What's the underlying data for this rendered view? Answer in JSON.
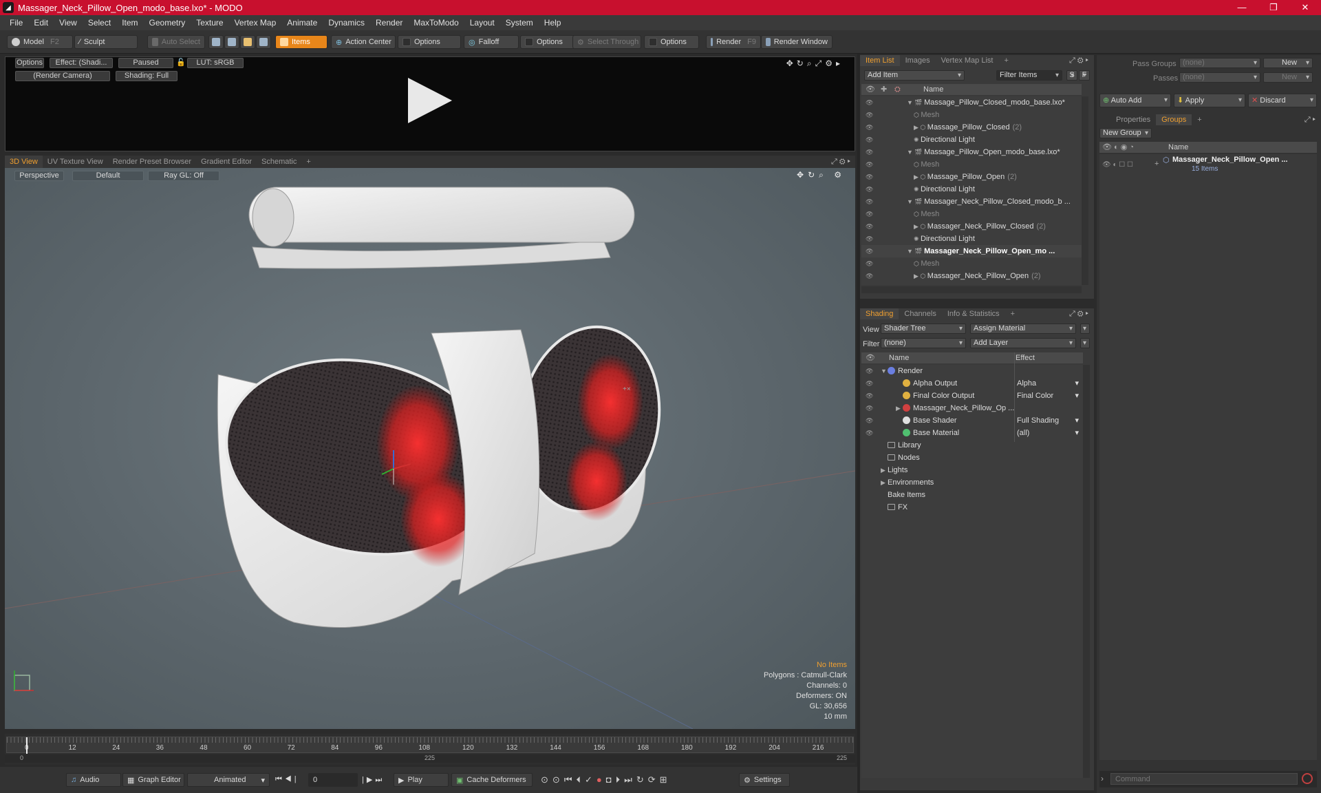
{
  "window": {
    "title": "Massager_Neck_Pillow_Open_modo_base.lxo* - MODO",
    "app_icon": "modo-logo-icon",
    "buttons": [
      "—",
      "❐",
      "✕"
    ]
  },
  "menu": [
    "File",
    "Edit",
    "View",
    "Select",
    "Item",
    "Geometry",
    "Texture",
    "Vertex Map",
    "Animate",
    "Dynamics",
    "Render",
    "MaxToModo",
    "Layout",
    "System",
    "Help"
  ],
  "toolbar": {
    "model": "Model",
    "model_key": "F2",
    "sculpt": "Sculpt",
    "auto_select": "Auto Select",
    "items": "Items",
    "action_center": "Action Center",
    "options1": "Options",
    "falloff": "Falloff",
    "options2": "Options",
    "select_through": "Select Through",
    "options3": "Options",
    "render": "Render",
    "render_key": "F9",
    "render_window": "Render Window"
  },
  "preview": {
    "options": "Options",
    "effect": "Effect: (Shadi...",
    "paused": "Paused",
    "lut": "LUT: sRGB",
    "camera": "(Render Camera)",
    "shading": "Shading: Full"
  },
  "viewport_tabs": [
    "3D View",
    "UV Texture View",
    "Render Preset Browser",
    "Gradient Editor",
    "Schematic",
    "+"
  ],
  "viewport": {
    "perspective": "Perspective",
    "default": "Default",
    "raygl": "Ray GL: Off",
    "stats": {
      "no_items": "No Items",
      "polygons": "Polygons : Catmull-Clark",
      "channels": "Channels: 0",
      "deformers": "Deformers: ON",
      "gl": "GL: 30,656",
      "scale": "10 mm"
    }
  },
  "timeline": {
    "ticks": [
      "0",
      "12",
      "24",
      "36",
      "48",
      "60",
      "72",
      "84",
      "96",
      "108",
      "120",
      "132",
      "144",
      "156",
      "168",
      "180",
      "192",
      "204",
      "216"
    ],
    "start": "0",
    "end_mid": "225",
    "end": "225"
  },
  "bottombar": {
    "audio": "Audio",
    "graph_editor": "Graph Editor",
    "animated": "Animated",
    "frame": "0",
    "play": "Play",
    "cache_deformers": "Cache Deformers",
    "settings": "Settings"
  },
  "item_list": {
    "tabs": [
      "Item List",
      "Images",
      "Vertex Map List",
      "+"
    ],
    "add_item": "Add Item",
    "filter_items": "Filter Items",
    "s_btn": "S",
    "f_btn": "F",
    "col_name": "Name",
    "rows": [
      {
        "label": "Massage_Pillow_Closed_modo_base.lxo*",
        "indent": 0,
        "kind": "scene",
        "count": ""
      },
      {
        "label": "Mesh",
        "indent": 1,
        "kind": "mesh",
        "count": ""
      },
      {
        "label": "Massage_Pillow_Closed",
        "indent": 1,
        "kind": "group",
        "count": "(2)"
      },
      {
        "label": "Directional Light",
        "indent": 1,
        "kind": "light",
        "count": ""
      },
      {
        "label": "Massage_Pillow_Open_modo_base.lxo*",
        "indent": 0,
        "kind": "scene",
        "count": ""
      },
      {
        "label": "Mesh",
        "indent": 1,
        "kind": "mesh",
        "count": ""
      },
      {
        "label": "Massage_Pillow_Open",
        "indent": 1,
        "kind": "group",
        "count": "(2)"
      },
      {
        "label": "Directional Light",
        "indent": 1,
        "kind": "light",
        "count": ""
      },
      {
        "label": "Massager_Neck_Pillow_Closed_modo_b ...",
        "indent": 0,
        "kind": "scene",
        "count": ""
      },
      {
        "label": "Mesh",
        "indent": 1,
        "kind": "mesh",
        "count": ""
      },
      {
        "label": "Massager_Neck_Pillow_Closed",
        "indent": 1,
        "kind": "group",
        "count": "(2)"
      },
      {
        "label": "Directional Light",
        "indent": 1,
        "kind": "light",
        "count": ""
      },
      {
        "label": "Massager_Neck_Pillow_Open_mo ...",
        "indent": 0,
        "kind": "scene-bold",
        "count": ""
      },
      {
        "label": "Mesh",
        "indent": 1,
        "kind": "mesh",
        "count": ""
      },
      {
        "label": "Massager_Neck_Pillow_Open",
        "indent": 1,
        "kind": "group",
        "count": "(2)"
      }
    ]
  },
  "shading": {
    "tabs": [
      "Shading",
      "Channels",
      "Info & Statistics",
      "+"
    ],
    "view_label": "View",
    "view_value": "Shader Tree",
    "assign_material": "Assign Material",
    "filter_label": "Filter",
    "filter_value": "(none)",
    "add_layer": "Add Layer",
    "col_name": "Name",
    "col_effect": "Effect",
    "rows": [
      {
        "label": "Render",
        "effect": "",
        "indent": 0,
        "icon": "render-icon"
      },
      {
        "label": "Alpha Output",
        "effect": "Alpha",
        "indent": 1,
        "icon": "output-icon"
      },
      {
        "label": "Final Color Output",
        "effect": "Final Color",
        "indent": 1,
        "icon": "output-icon"
      },
      {
        "label": "Massager_Neck_Pillow_Op ...",
        "effect": "",
        "indent": 1,
        "icon": "material-group-icon"
      },
      {
        "label": "Base Shader",
        "effect": "Full Shading",
        "indent": 1,
        "icon": "shader-icon"
      },
      {
        "label": "Base Material",
        "effect": "(all)",
        "indent": 1,
        "icon": "material-icon"
      },
      {
        "label": "Library",
        "effect": "",
        "indent": 0,
        "icon": "folder-icon"
      },
      {
        "label": "Nodes",
        "effect": "",
        "indent": 0,
        "icon": "folder-icon"
      },
      {
        "label": "Lights",
        "effect": "",
        "indent": 0,
        "icon": ""
      },
      {
        "label": "Environments",
        "effect": "",
        "indent": 0,
        "icon": ""
      },
      {
        "label": "Bake Items",
        "effect": "",
        "indent": 0,
        "icon": ""
      },
      {
        "label": "FX",
        "effect": "",
        "indent": 0,
        "icon": "fx-icon"
      }
    ]
  },
  "groups_panel": {
    "pass_groups_label": "Pass Groups",
    "pass_groups_value": "(none)",
    "passes_label": "Passes",
    "passes_value": "(none)",
    "new_btn": "New",
    "new_btn2": "New",
    "auto_add": "Auto Add",
    "apply": "Apply",
    "discard": "Discard",
    "tabs": [
      "Properties",
      "Groups",
      "+"
    ],
    "new_group": "New Group",
    "col_name": "Name",
    "group_name": "Massager_Neck_Pillow_Open ...",
    "group_count": "15 Items"
  },
  "command": {
    "placeholder": "Command"
  },
  "colors": {
    "title_bar": "#c8102e",
    "accent": "#f0a030",
    "items_button": "#e8861a"
  }
}
